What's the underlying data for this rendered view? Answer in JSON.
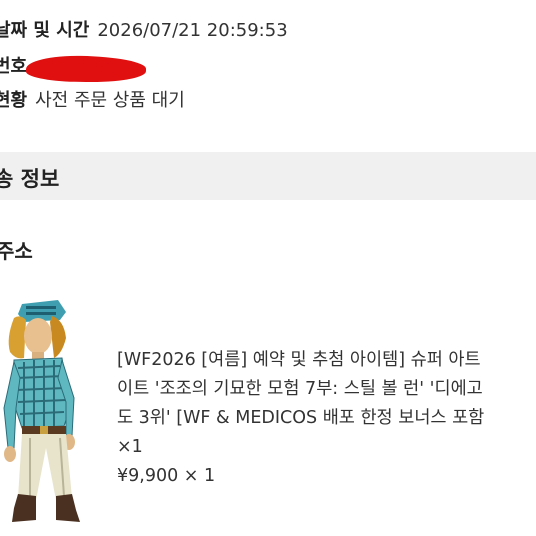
{
  "order": {
    "date_label": "날짜 및 시간",
    "date_value": "2026/07/21 20:59:53",
    "number_label": "번호",
    "number_value": "",
    "status_label": "현황",
    "status_value": "사전 주문 상품 대기"
  },
  "shipping": {
    "section_title": "송 정보",
    "address_title": "주소"
  },
  "product": {
    "image_icon": "action-figure-image",
    "name_lines": [
      "[WF2026 [여름] 예약 및 추첨 아이템] 슈퍼 아트",
      "이트 '조조의 기묘한 모험 7부: 스틸 볼 런' '디에고",
      "도 3위' [WF & MEDICOS 배포 한정 보너스 포함",
      "×1"
    ],
    "price": "¥9,900 × 1"
  },
  "colors": {
    "section_bar": "#f0f0f0",
    "redaction": "#e01010"
  }
}
